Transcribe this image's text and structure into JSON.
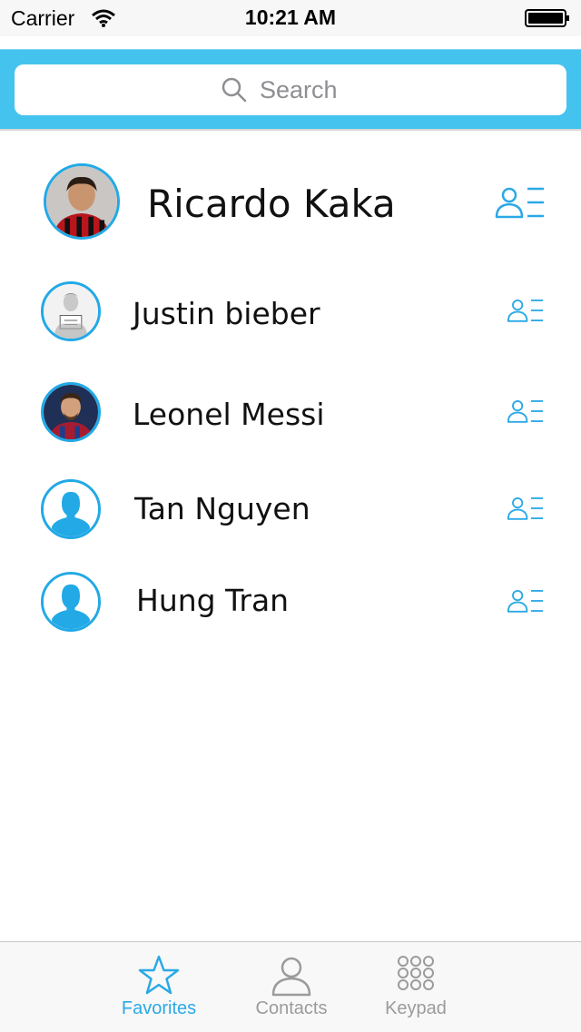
{
  "status_bar": {
    "carrier": "Carrier",
    "time": "10:21 AM"
  },
  "search": {
    "placeholder": "Search",
    "value": ""
  },
  "featured_contact": {
    "name": "Ricardo Kaka"
  },
  "contacts": [
    {
      "name": "Justin bieber"
    },
    {
      "name": "Leonel Messi"
    },
    {
      "name": "Tan Nguyen"
    },
    {
      "name": "Hung Tran"
    }
  ],
  "tab_bar": {
    "tabs": [
      {
        "label": "Favorites",
        "icon": "star-icon",
        "active": true
      },
      {
        "label": "Contacts",
        "icon": "person-icon",
        "active": false
      },
      {
        "label": "Keypad",
        "icon": "keypad-icon",
        "active": false
      }
    ]
  },
  "colors": {
    "accent": "#2aa9e6",
    "search_bar": "#44c3ee",
    "inactive": "#9b9b9b"
  }
}
